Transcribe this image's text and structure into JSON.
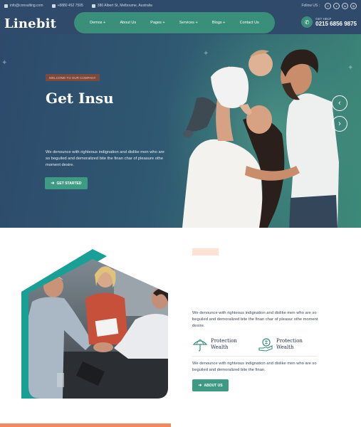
{
  "topbar": {
    "email": "info@consulting.com",
    "phone": "+8880 452 7505",
    "address": "380 Albert St, Melbourne, Australia",
    "follow_label": "Follow US :",
    "social": [
      {
        "icon": "facebook-icon",
        "glyph": "f"
      },
      {
        "icon": "twitter-icon",
        "glyph": "t"
      },
      {
        "icon": "linkedin-icon",
        "glyph": "in"
      },
      {
        "icon": "instagram-icon",
        "glyph": "◎"
      }
    ]
  },
  "header": {
    "logo": "Linebit",
    "nav": [
      "Demos +",
      "About Us",
      "Pages +",
      "Services +",
      "Blogs +",
      "Contact Us"
    ],
    "help_label": "GET HELP",
    "help_phone": "0215 6856 9875"
  },
  "hero": {
    "tag": "WELCOME TO OUR COMPANY",
    "title": "Get Insu",
    "text": "We denounce with righteous indignation and dislike men who are so beguiled and demoralized bite the finan char of pleasure othe moment desire.",
    "button": "GET STARTED",
    "prev": "‹",
    "next": "›"
  },
  "about": {
    "tag": "",
    "paragraph1": "We denounce with righteous indignation and dislike men who are so beguiled and demoralized bite the finan char of pleasur othe moment desire.",
    "features": [
      "Protection Wealth",
      "Protection Wealth"
    ],
    "paragraph2": "We denounce with righteous indignation and dislike men who are so beguiled and demoralized bite the finan.",
    "button": "ABOUT US"
  },
  "colors": {
    "navy": "#2f4a6a",
    "teal": "#3a8f7a",
    "accent_orange": "#f08a5d"
  }
}
